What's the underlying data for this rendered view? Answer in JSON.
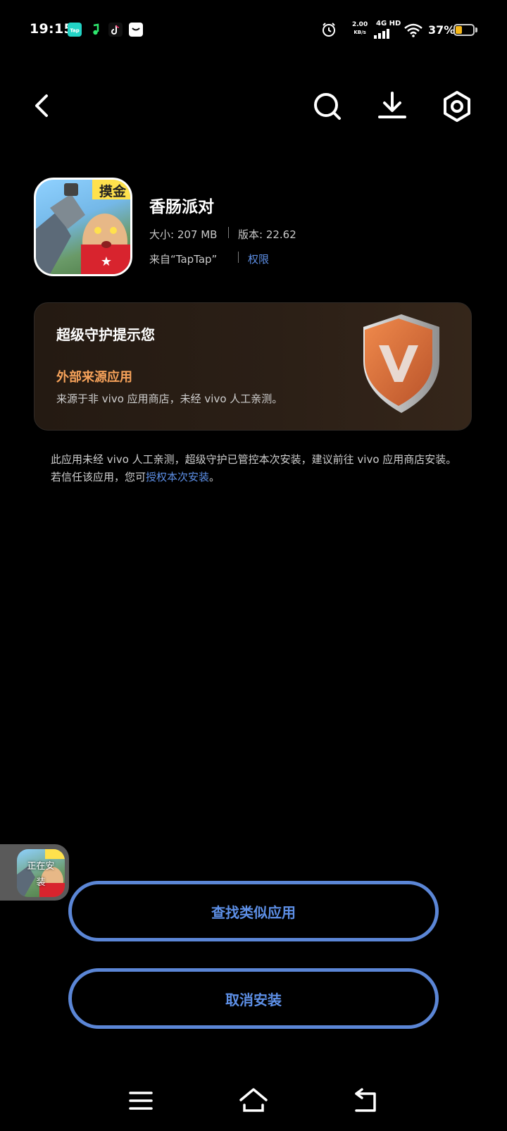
{
  "status_bar": {
    "time": "19:15",
    "notification_icons": [
      "taptap-icon",
      "music-icon",
      "tiktok-icon",
      "message-icon"
    ],
    "alarm_icon": "alarm-icon",
    "net_speed_value": "2.00",
    "net_speed_unit": "KB/s",
    "network_type": "4G HD",
    "battery_percent": "37%",
    "battery_level": 0.37
  },
  "toolbar": {
    "back_icon": "chevron-left-icon",
    "search_icon": "search-icon",
    "download_icon": "download-icon",
    "settings_icon": "settings-icon"
  },
  "app": {
    "icon_badge": "摸金",
    "name": "香肠派对",
    "size_label": "大小: 207 MB",
    "version_label": "版本: 22.62",
    "source_label": "来自“TapTap”",
    "permissions_link": "权限"
  },
  "security_card": {
    "title": "超级守护提示您",
    "subtitle": "外部来源应用",
    "description": "来源于非 vivo 应用商店，未经 vivo 人工亲测。",
    "shield_icon": "shield-v-icon",
    "accent_color": "#f6a25a"
  },
  "notice": {
    "text": "此应用未经 vivo 人工亲测，超级守护已管控本次安装，建议前往 vivo 应用商店安装。若信任该应用，您可",
    "link": "授权本次安装",
    "suffix": "。"
  },
  "floating": {
    "status": "正在安装"
  },
  "buttons": {
    "find_similar": "查找类似应用",
    "cancel_install": "取消安装",
    "color": "#5b86d6"
  },
  "nav_bar": {
    "menu_icon": "menu-icon",
    "home_icon": "home-icon",
    "back_icon": "back-icon"
  }
}
